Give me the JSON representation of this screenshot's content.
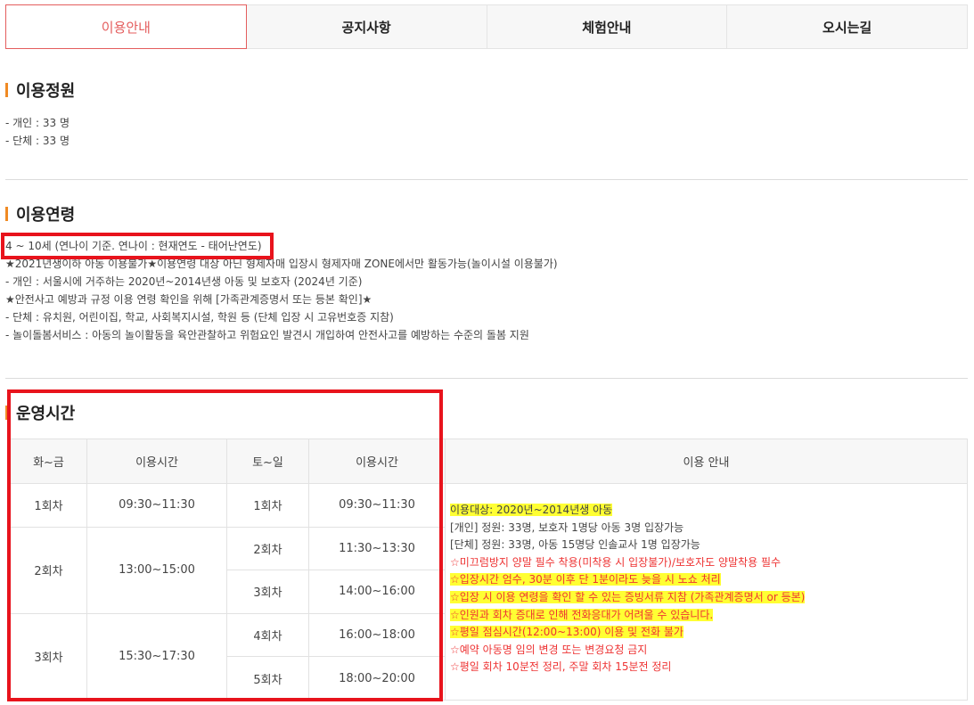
{
  "tabs": [
    "이용안내",
    "공지사항",
    "체험안내",
    "오시는길"
  ],
  "capacity": {
    "title": "이용정원",
    "lines": [
      "- 개인 : 33 명",
      "- 단체 : 33 명"
    ]
  },
  "age": {
    "title": "이용연령",
    "lines": [
      "4 ~ 10세 (연나이 기준. 연나이 : 현재연도 - 태어난연도)",
      "★2021년생이하 아동 이용불가★이용연령 대상 아닌 형제자매 입장시 형제자매 ZONE에서만 활동가능(놀이시설 이용불가)",
      "- 개인 : 서울시에 거주하는 2020년~2014년생 아동 및 보호자 (2024년 기준)",
      "★안전사고 예방과 규정 이용 연령 확인을 위해 [가족관계증명서 또는 등본 확인]★",
      "- 단체 : 유치원, 어린이집, 학교, 사회복지시설, 학원 등 (단체 입장 시 고유번호증 지참)",
      "- 놀이돌봄서비스 : 아동의 놀이활동을 육안관찰하고 위험요인 발견시 개입하여 안전사고를 예방하는 수준의 돌봄 지원"
    ]
  },
  "hours": {
    "title": "운영시간",
    "headers": [
      "화~금",
      "이용시간",
      "토~일",
      "이용시간",
      "이용 안내"
    ],
    "weekday": [
      {
        "session": "1회차",
        "time": "09:30~11:30"
      },
      {
        "session": "2회차",
        "time": "13:00~15:00"
      },
      {
        "session": "3회차",
        "time": "15:30~17:30"
      }
    ],
    "weekend": [
      {
        "session": "1회차",
        "time": "09:30~11:30"
      },
      {
        "session": "2회차",
        "time": "11:30~13:30"
      },
      {
        "session": "3회차",
        "time": "14:00~16:00"
      },
      {
        "session": "4회차",
        "time": "16:00~18:00"
      },
      {
        "session": "5회차",
        "time": "18:00~20:00"
      }
    ],
    "info": [
      {
        "text": "이용대상: 2020년~2014년생 아동",
        "color": "dark",
        "highlight": true
      },
      {
        "text": "[개인] 정원: 33명, 보호자 1명당 아동 3명 입장가능",
        "color": "dark",
        "highlight": false
      },
      {
        "text": "[단체] 정원: 33명, 아동 15명당 인솔교사 1명 입장가능",
        "color": "dark",
        "highlight": false
      },
      {
        "text": "☆미끄럼방지 양말 필수 착용(미착용 시 입장불가)/보호자도 양말착용 필수",
        "color": "red",
        "highlight": false
      },
      {
        "text": "☆입장시간 엄수, 30분 이후 단 1분이라도 늦을 시 노쇼 처리",
        "color": "red",
        "highlight": true
      },
      {
        "text": "☆입장 시 이용 연령을 확인 할 수 있는 증빙서류 지참 (가족관계증명서 or 등본)",
        "color": "red",
        "highlight": true
      },
      {
        "text": "☆인원과 회차 증대로 인해 전화응대가 어려울 수 있습니다.",
        "color": "red",
        "highlight": true
      },
      {
        "text": "☆평일 점심시간(12:00~13:00) 이용 및 전화 불가",
        "color": "red",
        "highlight": true
      },
      {
        "text": "☆예약 아동명 임의 변경 또는 변경요청 금지",
        "color": "red",
        "highlight": false
      },
      {
        "text": "☆평일 회차 10분전 정리, 주말 회차 15분전 정리",
        "color": "red",
        "highlight": false
      }
    ]
  },
  "colors": {
    "accent": "#e45d5d",
    "title_bar": "#f08a24",
    "annotation_box": "#e8131c",
    "highlight": "#ffff33",
    "notice_red": "#ee3333"
  }
}
